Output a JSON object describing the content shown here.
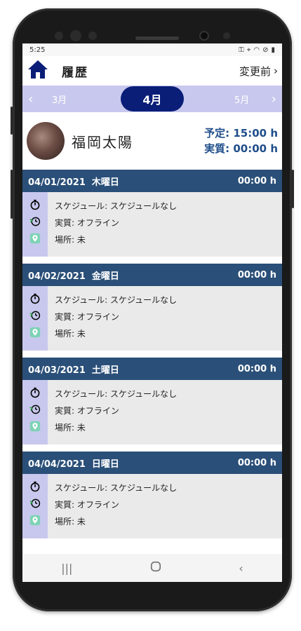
{
  "status_bar": {
    "time": "5:25",
    "icons": [
      "key-icon",
      "location-icon",
      "wifi-icon",
      "dnd-icon",
      "battery-icon"
    ]
  },
  "header": {
    "title": "履歴",
    "right_label": "変更前",
    "icon": "home-icon",
    "accent": "#0a1e78"
  },
  "month_nav": {
    "prev": "3月",
    "current": "4月",
    "next": "5月"
  },
  "profile": {
    "name": "福岡太陽",
    "scheduled": "予定: 15:00 h",
    "actual": "実質: 00:00 h"
  },
  "days": [
    {
      "date": "04/01/2021",
      "weekday": "木曜日",
      "total": "00:00 h",
      "schedule": "スケジュール: スケジュールなし",
      "actual": "実質: オフライン",
      "place": "場所: 未"
    },
    {
      "date": "04/02/2021",
      "weekday": "金曜日",
      "total": "00:00 h",
      "schedule": "スケジュール: スケジュールなし",
      "actual": "実質: オフライン",
      "place": "場所: 未"
    },
    {
      "date": "04/03/2021",
      "weekday": "土曜日",
      "total": "00:00 h",
      "schedule": "スケジュール: スケジュールなし",
      "actual": "実質: オフライン",
      "place": "場所: 未"
    },
    {
      "date": "04/04/2021",
      "weekday": "日曜日",
      "total": "00:00 h",
      "schedule": "スケジュール: スケジュールなし",
      "actual": "実質: オフライン",
      "place": "場所: 未"
    }
  ],
  "colors": {
    "day_header": "#2a4f78",
    "month_bar": "#c8c8ee",
    "current_month": "#0a1e78",
    "times_text": "#1f4e8a"
  },
  "nav_bar": {
    "icons": [
      "recent-apps-icon",
      "home-circle-icon",
      "back-icon"
    ]
  }
}
